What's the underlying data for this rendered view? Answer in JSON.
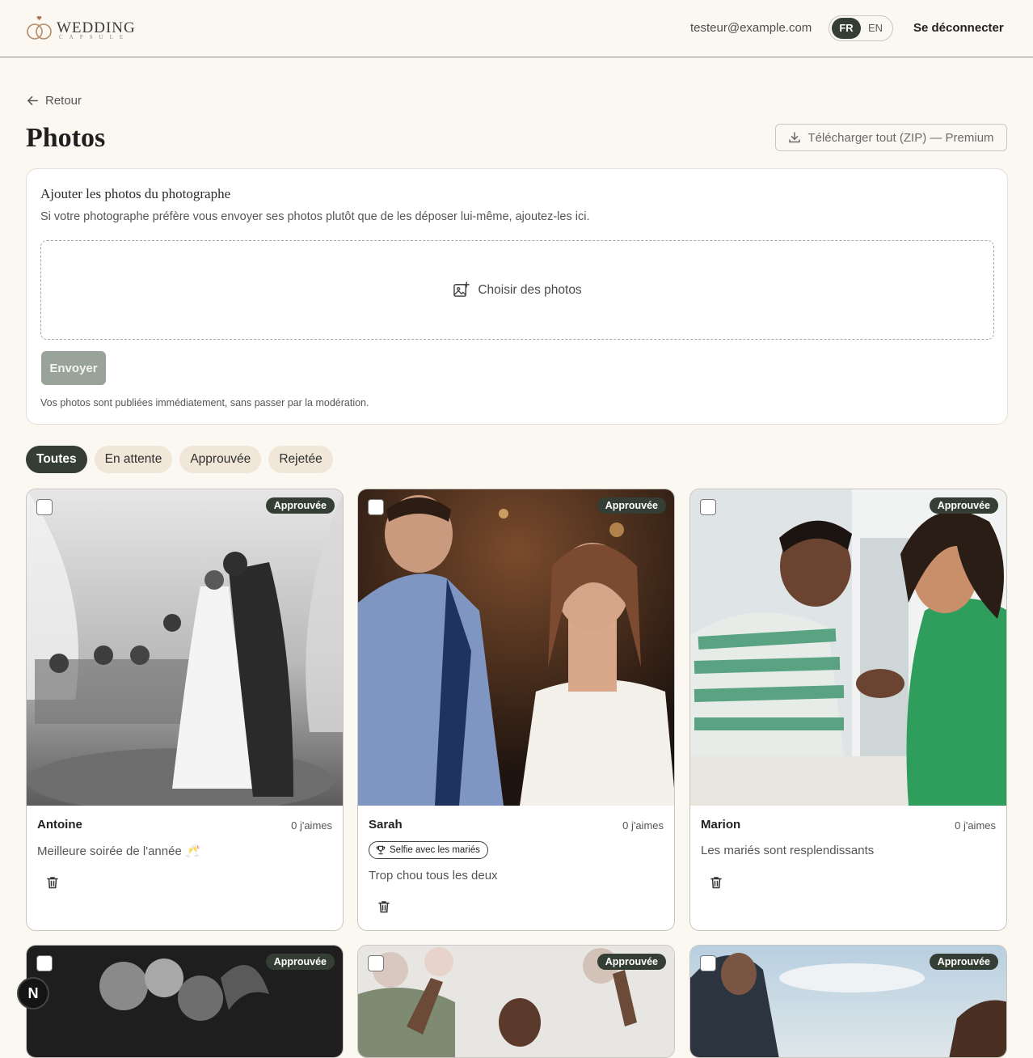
{
  "header": {
    "brand": "WEDDING",
    "brand_sub": "CAPSULE",
    "email": "testeur@example.com",
    "lang_fr": "FR",
    "lang_en": "EN",
    "logout": "Se déconnecter"
  },
  "page": {
    "back": "Retour",
    "title": "Photos",
    "zip_button": "Télécharger tout (ZIP) — Premium"
  },
  "upload": {
    "title": "Ajouter les photos du photographe",
    "description": "Si votre photographe préfère vous envoyer ses photos plutôt que de les déposer lui-même, ajoutez-les ici.",
    "choose": "Choisir des photos",
    "send": "Envoyer",
    "note": "Vos photos sont publiées immédiatement, sans passer par la modération."
  },
  "filters": [
    "Toutes",
    "En attente",
    "Approuvée",
    "Rejetée"
  ],
  "cards": [
    {
      "status": "Approuvée",
      "name": "Antoine",
      "likes": "0 j'aimes",
      "caption": "Meilleure soirée de l'année 🥂",
      "award": ""
    },
    {
      "status": "Approuvée",
      "name": "Sarah",
      "likes": "0 j'aimes",
      "caption": "Trop chou tous les deux",
      "award": "Selfie avec les mariés"
    },
    {
      "status": "Approuvée",
      "name": "Marion",
      "likes": "0 j'aimes",
      "caption": "Les mariés sont resplendissants",
      "award": ""
    },
    {
      "status": "Approuvée"
    },
    {
      "status": "Approuvée"
    },
    {
      "status": "Approuvée"
    }
  ],
  "fab": "N",
  "colors": {
    "primary": "#343e34",
    "chip": "#f0e7d9",
    "background": "#fbf8f2"
  }
}
